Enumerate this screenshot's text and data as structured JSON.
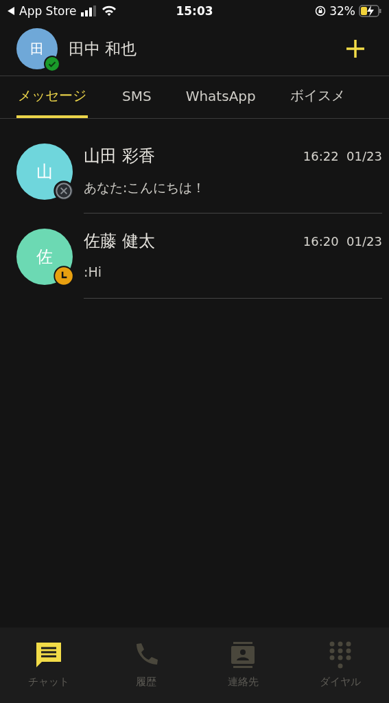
{
  "status_bar": {
    "back_label": "App Store",
    "time": "15:03",
    "battery": "32%"
  },
  "header": {
    "avatar_initial": "田",
    "name": "田中 和也",
    "badge": {
      "kind": "online"
    }
  },
  "tabs": [
    {
      "label": "メッセージ",
      "selected": true
    },
    {
      "label": "SMS",
      "selected": false
    },
    {
      "label": "WhatsApp",
      "selected": false
    },
    {
      "label": "ボイスメ",
      "selected": false
    }
  ],
  "chats": [
    {
      "initial": "山",
      "color": "#6fd6dc",
      "badge": {
        "kind": "offline"
      },
      "name": "山田 彩香",
      "time": "16:22  01/23",
      "preview": "あなた:こんにちは！"
    },
    {
      "initial": "佐",
      "color": "#6cd9b3",
      "badge": {
        "kind": "away"
      },
      "name": "佐藤 健太",
      "time": "16:20  01/23",
      "preview": ":Hi"
    }
  ],
  "bottom_nav": [
    {
      "kind": "chat",
      "label": "チャット",
      "selected": true
    },
    {
      "kind": "phone",
      "label": "履歴",
      "selected": false
    },
    {
      "kind": "contacts",
      "label": "連絡先",
      "selected": false
    },
    {
      "kind": "dialpad",
      "label": "ダイヤル",
      "selected": false
    }
  ]
}
